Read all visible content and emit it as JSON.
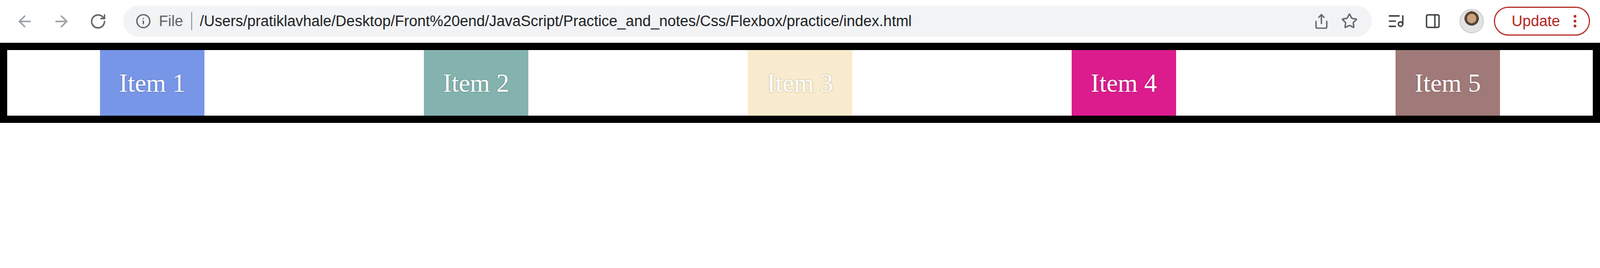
{
  "browser": {
    "address": {
      "scheme_label": "File",
      "url": "/Users/pratiklavhale/Desktop/Front%20end/JavaScript/Practice_and_notes/Css/Flexbox/practice/index.html"
    },
    "update_button": "Update"
  },
  "page": {
    "items": [
      {
        "label": "Item 1",
        "color": "#7896e8"
      },
      {
        "label": "Item 2",
        "color": "#84b3af"
      },
      {
        "label": "Item 3",
        "color": "#f9ebcd"
      },
      {
        "label": "Item 4",
        "color": "#dc1c8d"
      },
      {
        "label": "Item 5",
        "color": "#a07a79"
      }
    ]
  }
}
